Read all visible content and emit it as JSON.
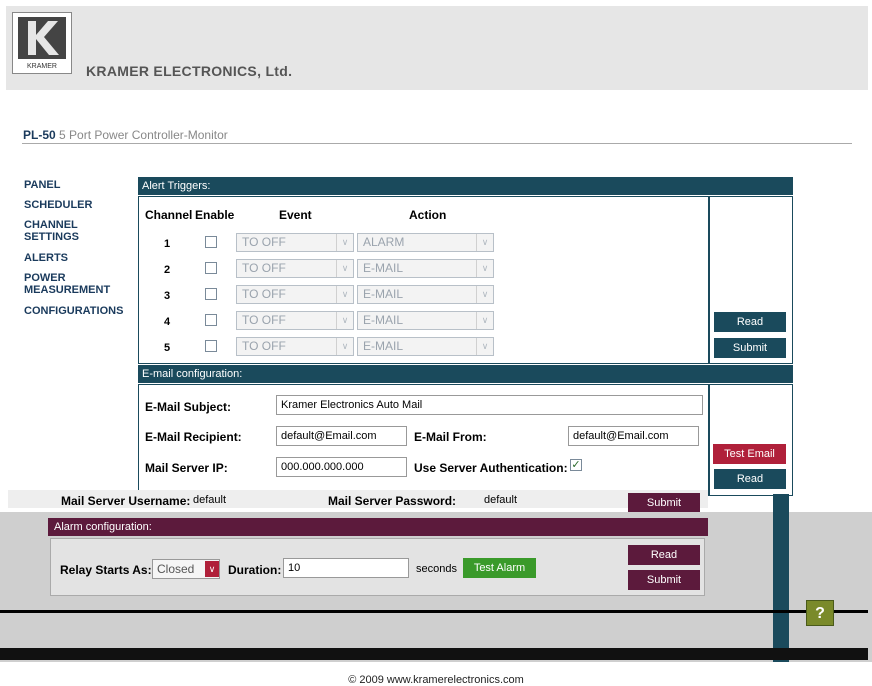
{
  "header": {
    "logo_text": "KRAMER",
    "company": "KRAMER ELECTRONICS, Ltd."
  },
  "device": {
    "model": "PL-50",
    "description": "5 Port Power Controller-Monitor"
  },
  "nav": [
    "PANEL",
    "SCHEDULER",
    "CHANNEL SETTINGS",
    "ALERTS",
    "POWER MEASUREMENT",
    "CONFIGURATIONS"
  ],
  "alert_triggers": {
    "title": "Alert Triggers:",
    "headers": {
      "channel": "Channel",
      "enable": "Enable",
      "event": "Event",
      "action": "Action"
    },
    "rows": [
      {
        "channel": "1",
        "event": "TO OFF",
        "action": "ALARM"
      },
      {
        "channel": "2",
        "event": "TO OFF",
        "action": "E-MAIL"
      },
      {
        "channel": "3",
        "event": "TO OFF",
        "action": "E-MAIL"
      },
      {
        "channel": "4",
        "event": "TO OFF",
        "action": "E-MAIL"
      },
      {
        "channel": "5",
        "event": "TO OFF",
        "action": "E-MAIL"
      }
    ],
    "read_label": "Read",
    "submit_label": "Submit"
  },
  "email": {
    "title": "E-mail configuration:",
    "subject_label": "E-Mail Subject:",
    "subject_value": "Kramer Electronics Auto Mail",
    "recipient_label": "E-Mail Recipient:",
    "recipient_value": "default@Email.com",
    "from_label": "E-Mail From:",
    "from_value": "default@Email.com",
    "server_ip_label": "Mail Server IP:",
    "server_ip_value": "000.000.000.000",
    "auth_label": "Use Server Authentication:",
    "auth_checked": true,
    "username_label": "Mail Server Username:",
    "username_value": "default",
    "password_label": "Mail Server Password:",
    "password_value": "default",
    "test_label": "Test Email",
    "read_label": "Read",
    "submit_label": "Submit"
  },
  "alarm": {
    "title": "Alarm configuration:",
    "relay_label": "Relay Starts As:",
    "relay_value": "Closed",
    "duration_label": "Duration:",
    "duration_value": "10",
    "seconds_label": "seconds",
    "test_label": "Test Alarm",
    "read_label": "Read",
    "submit_label": "Submit"
  },
  "help_label": "?",
  "footer": "© 2009 www.kramerelectronics.com"
}
